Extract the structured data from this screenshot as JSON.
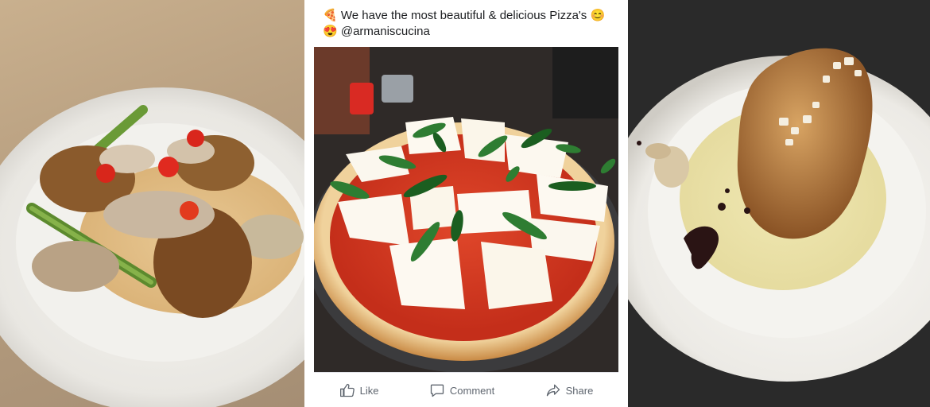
{
  "post": {
    "line1": "We have the most beautiful & delicious Pizza's",
    "line2": "@armaniscucina",
    "emoji_pizza": "🍕",
    "emoji_smile": "😊",
    "emoji_heart_eyes": "😍"
  },
  "actions": {
    "like": "Like",
    "comment": "Comment",
    "share": "Share"
  },
  "icons": [
    "thumbs-up-icon",
    "comment-icon",
    "share-icon"
  ]
}
